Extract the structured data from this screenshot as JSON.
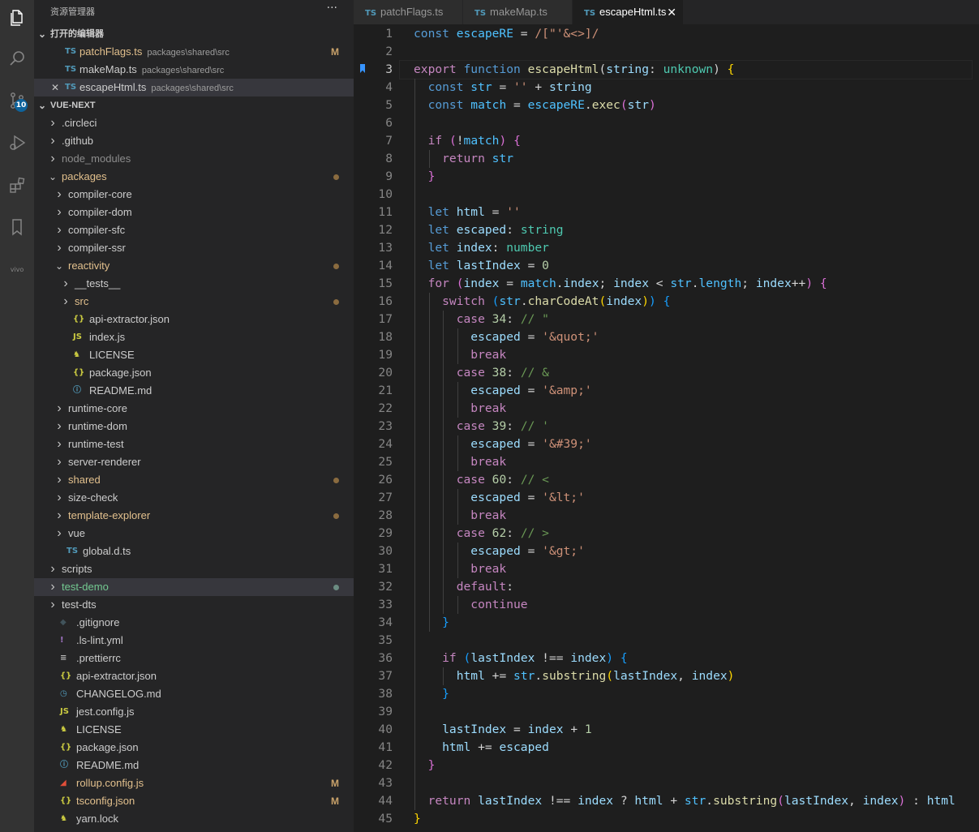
{
  "colors": {
    "activity_bar": "#333333",
    "sidebar": "#252526",
    "editor": "#1e1e1e",
    "keyword": "#569cd6",
    "variable": "#9cdcfe",
    "function": "#dcdcaa",
    "string": "#ce9178",
    "type": "#4ec9b0",
    "control": "#c586c0",
    "comment": "#6a9955",
    "number": "#b5cea8",
    "git_modified": "#e2c08d",
    "git_untracked": "#73c991"
  },
  "activity_bar": {
    "items": [
      {
        "name": "explorer-icon"
      },
      {
        "name": "search-icon"
      },
      {
        "name": "source-control-icon",
        "badge": "10"
      },
      {
        "name": "run-debug-icon"
      },
      {
        "name": "extensions-icon"
      },
      {
        "name": "bookmarks-icon"
      },
      {
        "name": "vivo-icon",
        "label": "vivo"
      }
    ]
  },
  "sidebar": {
    "title": "资源管理器",
    "more": "···",
    "open_editors_header": "打开的编辑器",
    "open_editors": [
      {
        "icon": "TS",
        "name": "patchFlags.ts",
        "path": "packages\\shared\\src",
        "status": "M",
        "color": "#e2c08d",
        "close": ""
      },
      {
        "icon": "TS",
        "name": "makeMap.ts",
        "path": "packages\\shared\\src",
        "status": "",
        "color": "#cccccc",
        "close": ""
      },
      {
        "icon": "TS",
        "name": "escapeHtml.ts",
        "path": "packages\\shared\\src",
        "status": "",
        "color": "#cccccc",
        "close": "✕"
      }
    ],
    "project_header": "VUE-NEXT",
    "tree": [
      {
        "label": ".circleci",
        "kind": "folder",
        "open": false,
        "depth": 0,
        "color": "#cccccc"
      },
      {
        "label": ".github",
        "kind": "folder",
        "open": false,
        "depth": 0,
        "color": "#cccccc"
      },
      {
        "label": "node_modules",
        "kind": "folder",
        "open": false,
        "depth": 0,
        "color": "#8c8c8c"
      },
      {
        "label": "packages",
        "kind": "folder",
        "open": true,
        "depth": 0,
        "color": "#e2c08d",
        "dot": "mod"
      },
      {
        "label": "compiler-core",
        "kind": "folder",
        "open": false,
        "depth": 1,
        "color": "#cccccc"
      },
      {
        "label": "compiler-dom",
        "kind": "folder",
        "open": false,
        "depth": 1,
        "color": "#cccccc"
      },
      {
        "label": "compiler-sfc",
        "kind": "folder",
        "open": false,
        "depth": 1,
        "color": "#cccccc"
      },
      {
        "label": "compiler-ssr",
        "kind": "folder",
        "open": false,
        "depth": 1,
        "color": "#cccccc"
      },
      {
        "label": "reactivity",
        "kind": "folder",
        "open": true,
        "depth": 1,
        "color": "#e2c08d",
        "dot": "mod"
      },
      {
        "label": "__tests__",
        "kind": "folder",
        "open": false,
        "depth": 2,
        "color": "#cccccc"
      },
      {
        "label": "src",
        "kind": "folder",
        "open": false,
        "depth": 2,
        "color": "#e2c08d",
        "dot": "mod"
      },
      {
        "label": "api-extractor.json",
        "kind": "file",
        "icon": "{}",
        "iconcls": "json",
        "depth": 2,
        "color": "#cccccc"
      },
      {
        "label": "index.js",
        "kind": "file",
        "icon": "JS",
        "iconcls": "js",
        "depth": 2,
        "color": "#cccccc"
      },
      {
        "label": "LICENSE",
        "kind": "file",
        "icon": "♞",
        "iconcls": "lic",
        "depth": 2,
        "color": "#cccccc"
      },
      {
        "label": "package.json",
        "kind": "file",
        "icon": "{}",
        "iconcls": "json",
        "depth": 2,
        "color": "#cccccc"
      },
      {
        "label": "README.md",
        "kind": "file",
        "icon": "ⓘ",
        "iconcls": "info",
        "depth": 2,
        "color": "#cccccc"
      },
      {
        "label": "runtime-core",
        "kind": "folder",
        "open": false,
        "depth": 1,
        "color": "#cccccc"
      },
      {
        "label": "runtime-dom",
        "kind": "folder",
        "open": false,
        "depth": 1,
        "color": "#cccccc"
      },
      {
        "label": "runtime-test",
        "kind": "folder",
        "open": false,
        "depth": 1,
        "color": "#cccccc"
      },
      {
        "label": "server-renderer",
        "kind": "folder",
        "open": false,
        "depth": 1,
        "color": "#cccccc"
      },
      {
        "label": "shared",
        "kind": "folder",
        "open": false,
        "depth": 1,
        "color": "#e2c08d",
        "dot": "mod"
      },
      {
        "label": "size-check",
        "kind": "folder",
        "open": false,
        "depth": 1,
        "color": "#cccccc"
      },
      {
        "label": "template-explorer",
        "kind": "folder",
        "open": false,
        "depth": 1,
        "color": "#e2c08d",
        "dot": "mod"
      },
      {
        "label": "vue",
        "kind": "folder",
        "open": false,
        "depth": 1,
        "color": "#cccccc"
      },
      {
        "label": "global.d.ts",
        "kind": "file",
        "icon": "TS",
        "iconcls": "ts",
        "depth": 1,
        "color": "#cccccc"
      },
      {
        "label": "scripts",
        "kind": "folder",
        "open": false,
        "depth": 0,
        "color": "#cccccc"
      },
      {
        "label": "test-demo",
        "kind": "folder",
        "open": false,
        "depth": 0,
        "color": "#73c991",
        "dot": "new",
        "selected": true
      },
      {
        "label": "test-dts",
        "kind": "folder",
        "open": false,
        "depth": 0,
        "color": "#cccccc"
      },
      {
        "label": ".gitignore",
        "kind": "file",
        "icon": "◆",
        "iconcls": "git",
        "depth": 0,
        "color": "#cccccc"
      },
      {
        "label": ".ls-lint.yml",
        "kind": "file",
        "icon": "!",
        "iconcls": "yml",
        "depth": 0,
        "color": "#cccccc"
      },
      {
        "label": ".prettierrc",
        "kind": "file",
        "icon": "≡",
        "iconcls": "pret",
        "depth": 0,
        "color": "#cccccc"
      },
      {
        "label": "api-extractor.json",
        "kind": "file",
        "icon": "{}",
        "iconcls": "json",
        "depth": 0,
        "color": "#cccccc"
      },
      {
        "label": "CHANGELOG.md",
        "kind": "file",
        "icon": "◷",
        "iconcls": "chg",
        "depth": 0,
        "color": "#cccccc"
      },
      {
        "label": "jest.config.js",
        "kind": "file",
        "icon": "JS",
        "iconcls": "js",
        "depth": 0,
        "color": "#cccccc"
      },
      {
        "label": "LICENSE",
        "kind": "file",
        "icon": "♞",
        "iconcls": "lic",
        "depth": 0,
        "color": "#cccccc"
      },
      {
        "label": "package.json",
        "kind": "file",
        "icon": "{}",
        "iconcls": "json",
        "depth": 0,
        "color": "#cccccc"
      },
      {
        "label": "README.md",
        "kind": "file",
        "icon": "ⓘ",
        "iconcls": "info",
        "depth": 0,
        "color": "#cccccc"
      },
      {
        "label": "rollup.config.js",
        "kind": "file",
        "icon": "◢",
        "iconcls": "rollup",
        "depth": 0,
        "color": "#e2c08d",
        "status": "M"
      },
      {
        "label": "tsconfig.json",
        "kind": "file",
        "icon": "{}",
        "iconcls": "json",
        "depth": 0,
        "color": "#e2c08d",
        "status": "M"
      },
      {
        "label": "yarn.lock",
        "kind": "file",
        "icon": "♞",
        "iconcls": "lic",
        "depth": 0,
        "color": "#cccccc"
      }
    ]
  },
  "tabs": [
    {
      "icon": "TS",
      "label": "patchFlags.ts",
      "active": false
    },
    {
      "icon": "TS",
      "label": "makeMap.ts",
      "active": false
    },
    {
      "icon": "TS",
      "label": "escapeHtml.ts",
      "active": true,
      "close": "✕"
    }
  ],
  "editor": {
    "current_line": 3,
    "bookmark_line": 3,
    "lines": [
      [
        [
          "const ",
          "kw"
        ],
        [
          "escapeRE",
          "cst"
        ],
        [
          " = ",
          ""
        ],
        [
          "/[\"'&<>]/",
          "str"
        ]
      ],
      [],
      [
        [
          "export ",
          "ctl"
        ],
        [
          "function ",
          "kw"
        ],
        [
          "escapeHtml",
          "fn"
        ],
        [
          "(",
          ""
        ],
        [
          "string",
          "var"
        ],
        [
          ": ",
          ""
        ],
        [
          "unknown",
          "typ"
        ],
        [
          ") ",
          ""
        ],
        [
          "{",
          "br1"
        ]
      ],
      [
        [
          "  const ",
          "kw"
        ],
        [
          "str",
          "cst"
        ],
        [
          " = ",
          ""
        ],
        [
          "''",
          "str"
        ],
        [
          " + ",
          ""
        ],
        [
          "string",
          "var"
        ]
      ],
      [
        [
          "  const ",
          "kw"
        ],
        [
          "match",
          "cst"
        ],
        [
          " = ",
          ""
        ],
        [
          "escapeRE",
          "cst"
        ],
        [
          ".",
          ""
        ],
        [
          "exec",
          "fn"
        ],
        [
          "(",
          "br2"
        ],
        [
          "str",
          "var"
        ],
        [
          ")",
          "br2"
        ]
      ],
      [],
      [
        [
          "  if ",
          "ctl"
        ],
        [
          "(",
          "br2"
        ],
        [
          "!",
          ""
        ],
        [
          "match",
          "cst"
        ],
        [
          ")",
          "br2"
        ],
        [
          " ",
          ""
        ],
        [
          "{",
          "br2"
        ]
      ],
      [
        [
          "    return ",
          "ctl"
        ],
        [
          "str",
          "cst"
        ]
      ],
      [
        [
          "  }",
          "br2"
        ]
      ],
      [],
      [
        [
          "  let ",
          "kw"
        ],
        [
          "html",
          "var"
        ],
        [
          " = ",
          ""
        ],
        [
          "''",
          "str"
        ]
      ],
      [
        [
          "  let ",
          "kw"
        ],
        [
          "escaped",
          "var"
        ],
        [
          ": ",
          ""
        ],
        [
          "string",
          "typ"
        ]
      ],
      [
        [
          "  let ",
          "kw"
        ],
        [
          "index",
          "var"
        ],
        [
          ": ",
          ""
        ],
        [
          "number",
          "typ"
        ]
      ],
      [
        [
          "  let ",
          "kw"
        ],
        [
          "lastIndex",
          "var"
        ],
        [
          " = ",
          ""
        ],
        [
          "0",
          "num"
        ]
      ],
      [
        [
          "  for ",
          "ctl"
        ],
        [
          "(",
          "br2"
        ],
        [
          "index",
          "var"
        ],
        [
          " = ",
          ""
        ],
        [
          "match",
          "cst"
        ],
        [
          ".",
          ""
        ],
        [
          "index",
          "var"
        ],
        [
          "; ",
          ""
        ],
        [
          "index",
          "var"
        ],
        [
          " < ",
          ""
        ],
        [
          "str",
          "cst"
        ],
        [
          ".",
          ""
        ],
        [
          "length",
          "cst"
        ],
        [
          "; ",
          ""
        ],
        [
          "index",
          "var"
        ],
        [
          "++",
          ""
        ],
        [
          ")",
          "br2"
        ],
        [
          " ",
          ""
        ],
        [
          "{",
          "br2"
        ]
      ],
      [
        [
          "    switch ",
          "ctl"
        ],
        [
          "(",
          "br3"
        ],
        [
          "str",
          "cst"
        ],
        [
          ".",
          ""
        ],
        [
          "charCodeAt",
          "fn"
        ],
        [
          "(",
          "br1"
        ],
        [
          "index",
          "var"
        ],
        [
          ")",
          "br1"
        ],
        [
          ")",
          "br3"
        ],
        [
          " ",
          ""
        ],
        [
          "{",
          "br3"
        ]
      ],
      [
        [
          "      case ",
          "ctl"
        ],
        [
          "34",
          "num"
        ],
        [
          ": ",
          ""
        ],
        [
          "// \"",
          "cmt"
        ]
      ],
      [
        [
          "        escaped",
          "var"
        ],
        [
          " = ",
          ""
        ],
        [
          "'&quot;'",
          "str"
        ]
      ],
      [
        [
          "        break",
          "ctl"
        ]
      ],
      [
        [
          "      case ",
          "ctl"
        ],
        [
          "38",
          "num"
        ],
        [
          ": ",
          ""
        ],
        [
          "// &",
          "cmt"
        ]
      ],
      [
        [
          "        escaped",
          "var"
        ],
        [
          " = ",
          ""
        ],
        [
          "'&amp;'",
          "str"
        ]
      ],
      [
        [
          "        break",
          "ctl"
        ]
      ],
      [
        [
          "      case ",
          "ctl"
        ],
        [
          "39",
          "num"
        ],
        [
          ": ",
          ""
        ],
        [
          "// '",
          "cmt"
        ]
      ],
      [
        [
          "        escaped",
          "var"
        ],
        [
          " = ",
          ""
        ],
        [
          "'&#39;'",
          "str"
        ]
      ],
      [
        [
          "        break",
          "ctl"
        ]
      ],
      [
        [
          "      case ",
          "ctl"
        ],
        [
          "60",
          "num"
        ],
        [
          ": ",
          ""
        ],
        [
          "// <",
          "cmt"
        ]
      ],
      [
        [
          "        escaped",
          "var"
        ],
        [
          " = ",
          ""
        ],
        [
          "'&lt;'",
          "str"
        ]
      ],
      [
        [
          "        break",
          "ctl"
        ]
      ],
      [
        [
          "      case ",
          "ctl"
        ],
        [
          "62",
          "num"
        ],
        [
          ": ",
          ""
        ],
        [
          "// >",
          "cmt"
        ]
      ],
      [
        [
          "        escaped",
          "var"
        ],
        [
          " = ",
          ""
        ],
        [
          "'&gt;'",
          "str"
        ]
      ],
      [
        [
          "        break",
          "ctl"
        ]
      ],
      [
        [
          "      default",
          "ctl"
        ],
        [
          ":",
          ""
        ]
      ],
      [
        [
          "        continue",
          "ctl"
        ]
      ],
      [
        [
          "    }",
          "br3"
        ]
      ],
      [],
      [
        [
          "    if ",
          "ctl"
        ],
        [
          "(",
          "br3"
        ],
        [
          "lastIndex",
          "var"
        ],
        [
          " !== ",
          ""
        ],
        [
          "index",
          "var"
        ],
        [
          ")",
          "br3"
        ],
        [
          " ",
          ""
        ],
        [
          "{",
          "br3"
        ]
      ],
      [
        [
          "      html",
          "var"
        ],
        [
          " += ",
          ""
        ],
        [
          "str",
          "cst"
        ],
        [
          ".",
          ""
        ],
        [
          "substring",
          "fn"
        ],
        [
          "(",
          "br1"
        ],
        [
          "lastIndex",
          "var"
        ],
        [
          ", ",
          ""
        ],
        [
          "index",
          "var"
        ],
        [
          ")",
          "br1"
        ]
      ],
      [
        [
          "    }",
          "br3"
        ]
      ],
      [],
      [
        [
          "    lastIndex",
          "var"
        ],
        [
          " = ",
          ""
        ],
        [
          "index",
          "var"
        ],
        [
          " + ",
          ""
        ],
        [
          "1",
          "num"
        ]
      ],
      [
        [
          "    html",
          "var"
        ],
        [
          " += ",
          ""
        ],
        [
          "escaped",
          "var"
        ]
      ],
      [
        [
          "  }",
          "br2"
        ]
      ],
      [],
      [
        [
          "  return ",
          "ctl"
        ],
        [
          "lastIndex",
          "var"
        ],
        [
          " !== ",
          ""
        ],
        [
          "index",
          "var"
        ],
        [
          " ? ",
          ""
        ],
        [
          "html",
          "var"
        ],
        [
          " + ",
          ""
        ],
        [
          "str",
          "cst"
        ],
        [
          ".",
          ""
        ],
        [
          "substring",
          "fn"
        ],
        [
          "(",
          "br2"
        ],
        [
          "lastIndex",
          "var"
        ],
        [
          ", ",
          ""
        ],
        [
          "index",
          "var"
        ],
        [
          ")",
          "br2"
        ],
        [
          " : ",
          ""
        ],
        [
          "html",
          "var"
        ]
      ],
      [
        [
          "}",
          "br1"
        ]
      ]
    ]
  }
}
